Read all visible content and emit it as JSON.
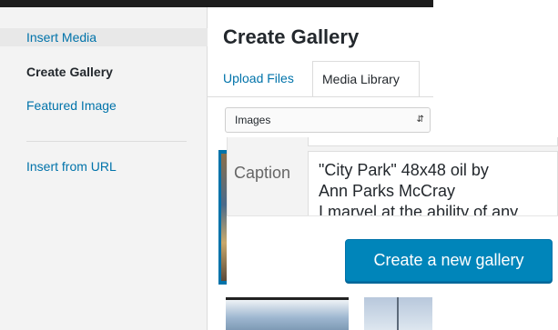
{
  "sidebar": {
    "items": [
      {
        "label": "Insert Media"
      },
      {
        "label": "Create Gallery"
      },
      {
        "label": "Featured Image"
      },
      {
        "label": "Insert from URL"
      }
    ]
  },
  "frame": {
    "title": "Create Gallery",
    "tabs": [
      {
        "label": "Upload Files"
      },
      {
        "label": "Media Library"
      }
    ],
    "filter": {
      "selected": "Images"
    }
  },
  "details": {
    "caption_label": "Caption",
    "caption_lines": [
      "\"City Park\" 48x48  oil by",
      "Ann Parks McCray",
      "I marvel at the ability of any"
    ]
  },
  "toolbar": {
    "primary_button": "Create a new gallery"
  },
  "colors": {
    "accent": "#0073aa",
    "button": "#0085ba"
  }
}
